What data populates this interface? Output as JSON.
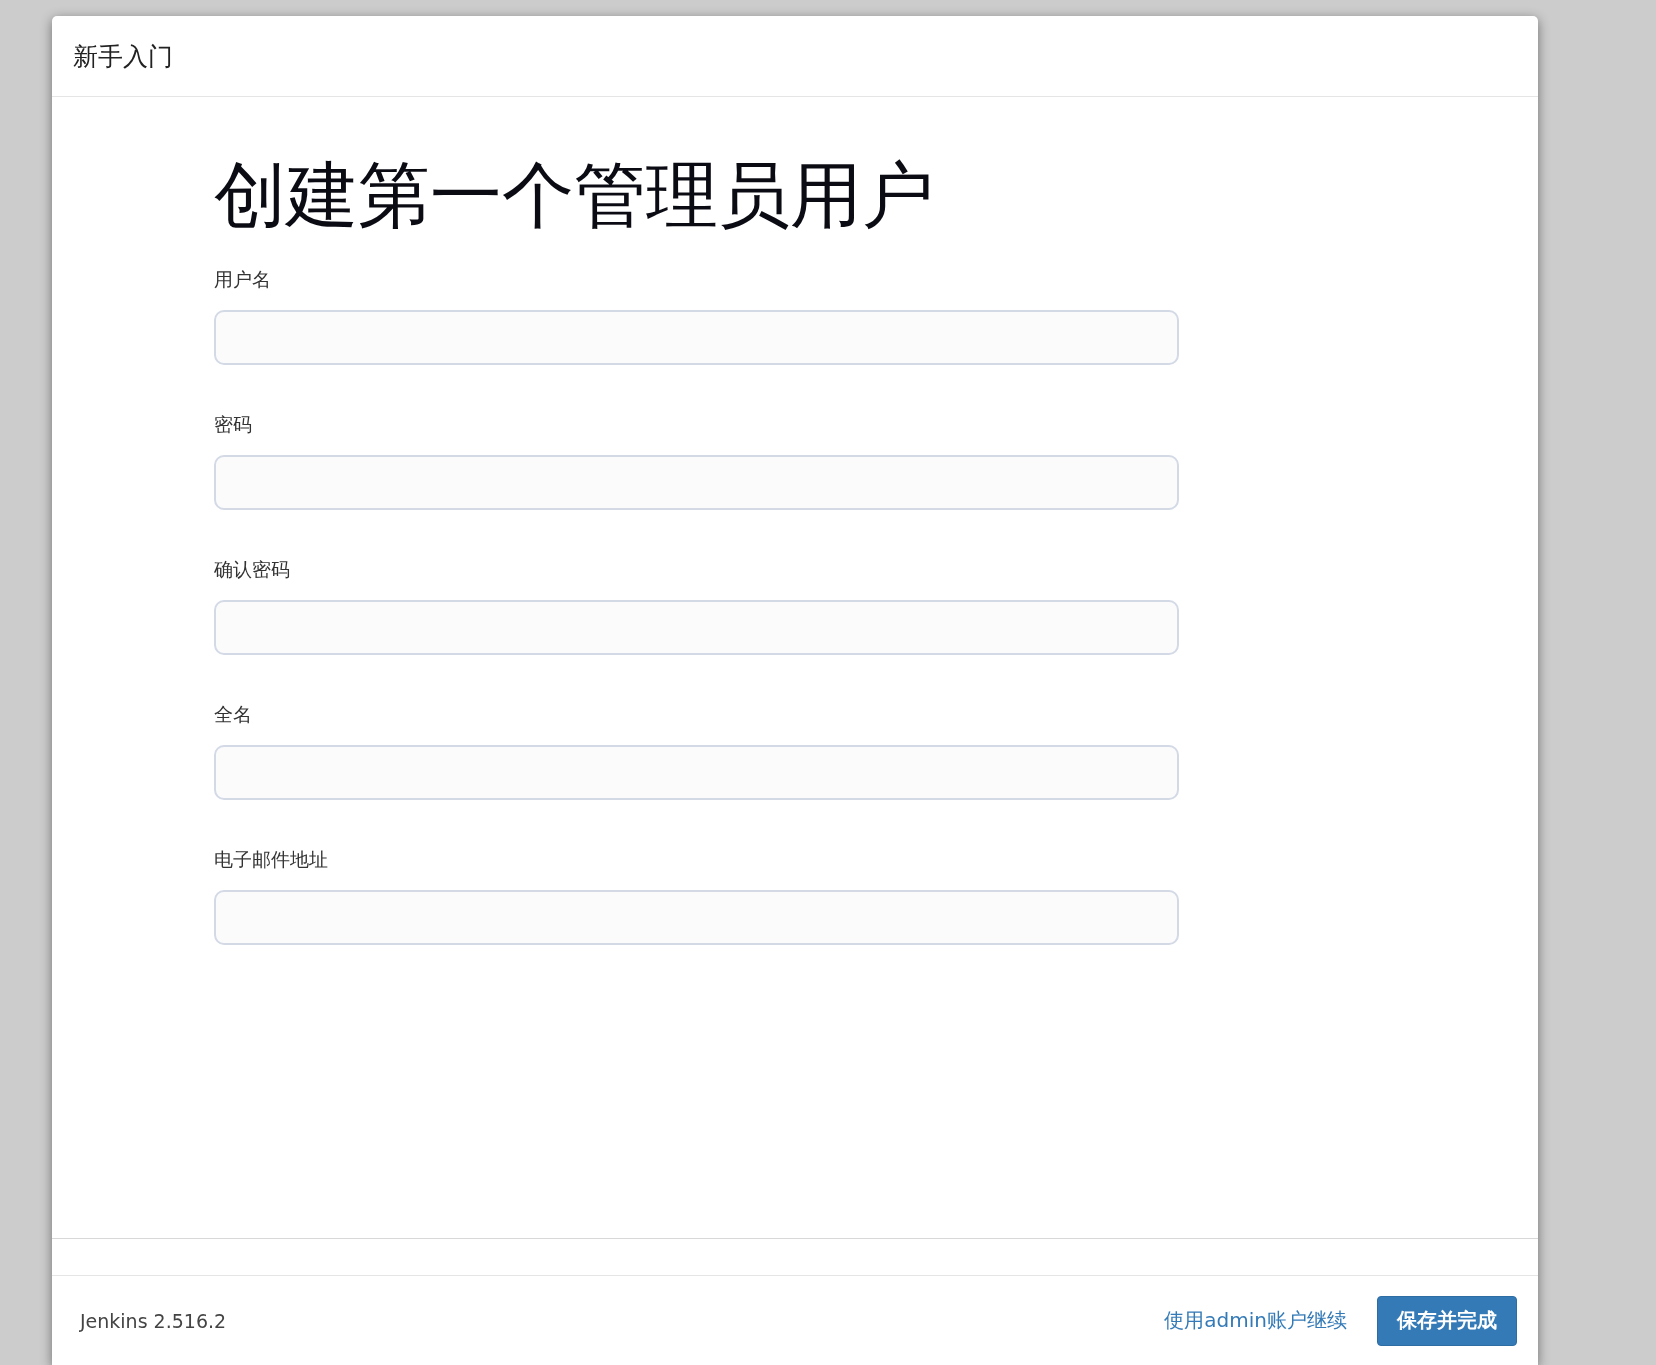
{
  "dialog": {
    "title": "新手入门"
  },
  "heading": "创建第一个管理员用户",
  "fields": [
    {
      "label": "用户名"
    },
    {
      "label": "密码"
    },
    {
      "label": "确认密码"
    },
    {
      "label": "全名"
    },
    {
      "label": "电子邮件地址"
    }
  ],
  "footer": {
    "version": "Jenkins 2.516.2",
    "link": "使用admin账户继续",
    "button": "保存并完成"
  }
}
